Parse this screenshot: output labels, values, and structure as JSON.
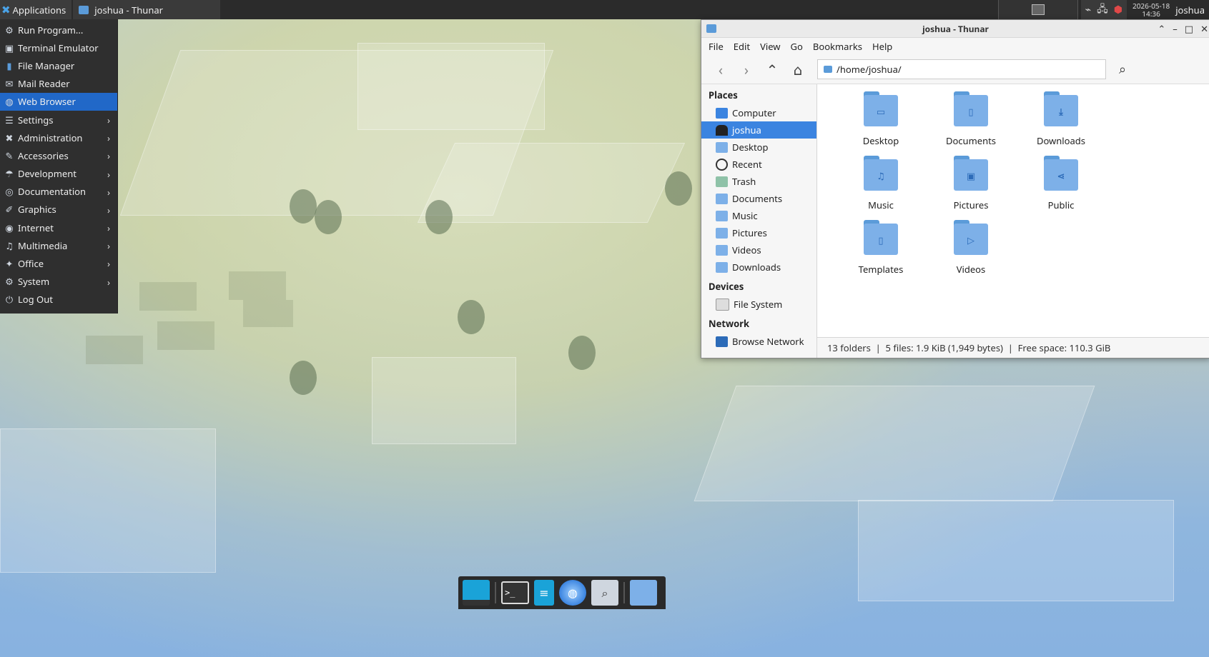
{
  "top_panel": {
    "applications_label": "Applications",
    "task_title": "joshua - Thunar",
    "clock_date": "2026-05-18",
    "clock_time": "14:36",
    "user": "joshua"
  },
  "app_menu": {
    "items": [
      {
        "label": "Run Program...",
        "icon": "run-icon",
        "submenu": false
      },
      {
        "label": "Terminal Emulator",
        "icon": "terminal-icon",
        "submenu": false
      },
      {
        "label": "File Manager",
        "icon": "file-manager-icon",
        "submenu": false
      },
      {
        "label": "Mail Reader",
        "icon": "mail-icon",
        "submenu": false
      },
      {
        "label": "Web Browser",
        "icon": "web-browser-icon",
        "submenu": false
      },
      {
        "label": "Settings",
        "icon": "settings-icon",
        "submenu": true
      },
      {
        "label": "Administration",
        "icon": "administration-icon",
        "submenu": true
      },
      {
        "label": "Accessories",
        "icon": "accessories-icon",
        "submenu": true
      },
      {
        "label": "Development",
        "icon": "development-icon",
        "submenu": true
      },
      {
        "label": "Documentation",
        "icon": "documentation-icon",
        "submenu": true
      },
      {
        "label": "Graphics",
        "icon": "graphics-icon",
        "submenu": true
      },
      {
        "label": "Internet",
        "icon": "internet-icon",
        "submenu": true
      },
      {
        "label": "Multimedia",
        "icon": "multimedia-icon",
        "submenu": true
      },
      {
        "label": "Office",
        "icon": "office-icon",
        "submenu": true
      },
      {
        "label": "System",
        "icon": "system-icon",
        "submenu": true
      },
      {
        "label": "Log Out",
        "icon": "logout-icon",
        "submenu": false
      }
    ],
    "highlighted": "Web Browser"
  },
  "thunar": {
    "title": "joshua - Thunar",
    "menubar": [
      "File",
      "Edit",
      "View",
      "Go",
      "Bookmarks",
      "Help"
    ],
    "location": "/home/joshua/",
    "sidebar": {
      "places_header": "Places",
      "places": [
        "Computer",
        "joshua",
        "Desktop",
        "Recent",
        "Trash",
        "Documents",
        "Music",
        "Pictures",
        "Videos",
        "Downloads"
      ],
      "selected": "joshua",
      "devices_header": "Devices",
      "devices": [
        "File System"
      ],
      "network_header": "Network",
      "network": [
        "Browse Network"
      ]
    },
    "items": [
      {
        "label": "Desktop",
        "icon": "desktop-folder-icon",
        "symbol": "▭"
      },
      {
        "label": "Documents",
        "icon": "documents-folder-icon",
        "symbol": "▯"
      },
      {
        "label": "Downloads",
        "icon": "downloads-folder-icon",
        "symbol": "⤓"
      },
      {
        "label": "Music",
        "icon": "music-folder-icon",
        "symbol": "♫"
      },
      {
        "label": "Pictures",
        "icon": "pictures-folder-icon",
        "symbol": "▣"
      },
      {
        "label": "Public",
        "icon": "public-folder-icon",
        "symbol": "⋖"
      },
      {
        "label": "Templates",
        "icon": "templates-folder-icon",
        "symbol": "▯"
      },
      {
        "label": "Videos",
        "icon": "videos-folder-icon",
        "symbol": "▷"
      }
    ],
    "status": "13 folders  |  5 files: 1.9 KiB (1,949 bytes)  |  Free space: 110.3 GiB"
  },
  "colors": {
    "panel_bg": "#2b2b2b",
    "menu_bg": "#2f2f2f",
    "highlight": "#2168c8",
    "selection": "#3b84e0",
    "folder": "#7db0e8"
  }
}
